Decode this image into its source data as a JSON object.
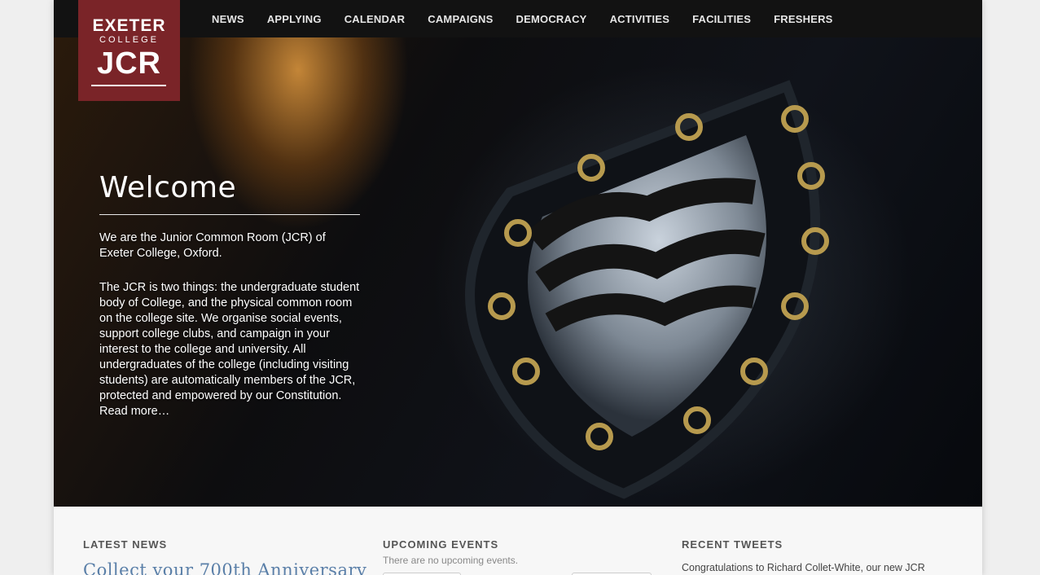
{
  "nav": {
    "items": [
      "NEWS",
      "APPLYING",
      "CALENDAR",
      "CAMPAIGNS",
      "DEMOCRACY",
      "ACTIVITIES",
      "FACILITIES",
      "FRESHERS"
    ]
  },
  "logo": {
    "line1": "EXETER",
    "line2": "COLLEGE",
    "line3": "JCR"
  },
  "hero": {
    "title": "Welcome",
    "paragraph1": "We are the Junior Common Room (JCR) of Exeter College, Oxford.",
    "paragraph2": "The JCR is two things: the undergraduate student body of College, and the physical common room on the college site. We organise social events, support college clubs, and campaign in your interest to the college and university. All undergraduates of the college (including visiting students) are automatically members of the JCR, protected and empowered by our Constitution.",
    "read_more": "Read more…"
  },
  "columns": {
    "news": {
      "heading": "LATEST NEWS",
      "first_link": "Collect your 700th Anniversary"
    },
    "events": {
      "heading": "UPCOMING EVENTS",
      "empty_text": "There are no upcoming events."
    },
    "tweets": {
      "heading": "RECENT TWEETS",
      "first_tweet": "Congratulations to Richard Collet-White, our new JCR"
    }
  },
  "colors": {
    "logo_bg": "#7a2428",
    "nav_bg": "#121212",
    "link": "#5a7fa8"
  }
}
